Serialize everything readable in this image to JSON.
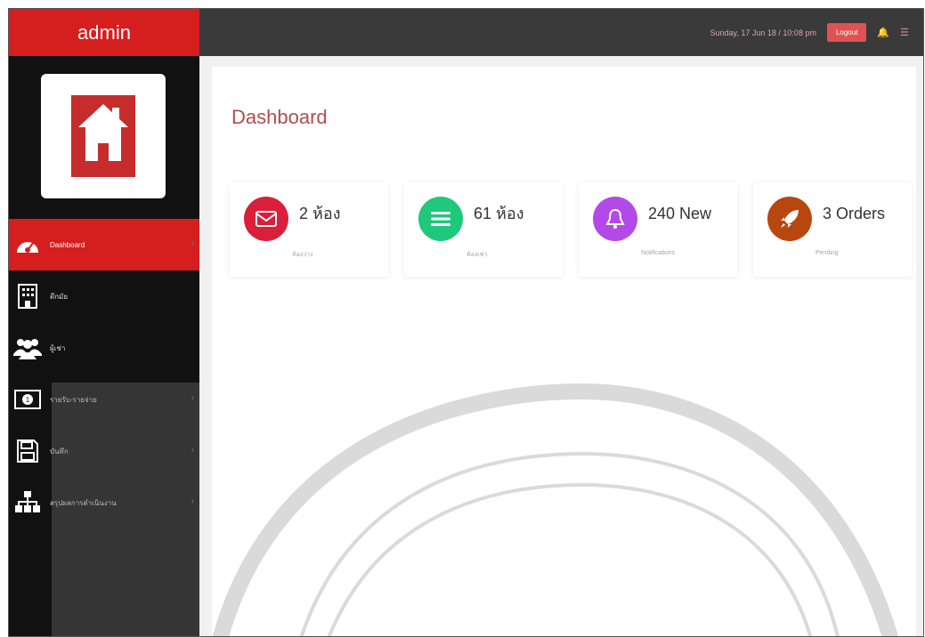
{
  "sidebar": {
    "brand": "admin",
    "items": [
      {
        "label": "Dashboard",
        "icon": "dashboard-gauge-icon",
        "active": true
      },
      {
        "label": "ตึกมัย",
        "icon": "building-icon"
      },
      {
        "label": "ผู้เช่า",
        "icon": "users-icon"
      },
      {
        "label": "รายรับ-รายจ่าย",
        "icon": "money-icon"
      },
      {
        "label": "บันทึก",
        "icon": "floppy-disk-icon"
      },
      {
        "label": "สรุปผลการดำเนินงาน",
        "icon": "org-chart-icon"
      }
    ]
  },
  "topbar": {
    "datetime": "Sunday, 17 Jun 18 / 10:08 pm",
    "logout_label": "Logout",
    "bell_icon": "bell-icon",
    "user_icon": "user-icon"
  },
  "main": {
    "title": "Dashboard",
    "cards": [
      {
        "value": "2 ห้อง",
        "sub": "ห้องว่าง",
        "color": "#d91f3a",
        "icon": "envelope-icon"
      },
      {
        "value": "61 ห้อง",
        "sub": "ห้องเช่า",
        "color": "#1fc87a",
        "icon": "list-icon"
      },
      {
        "value": "240 New",
        "sub": "Notifications",
        "color": "#b349e6",
        "icon": "bell-icon"
      },
      {
        "value": "3 Orders",
        "sub": "Pending",
        "color": "#b8470f",
        "icon": "rocket-icon"
      }
    ]
  },
  "colors": {
    "accent": "#d51f1f",
    "sidebar_bg": "#111111",
    "topbar_bg": "#3a3a3a"
  }
}
